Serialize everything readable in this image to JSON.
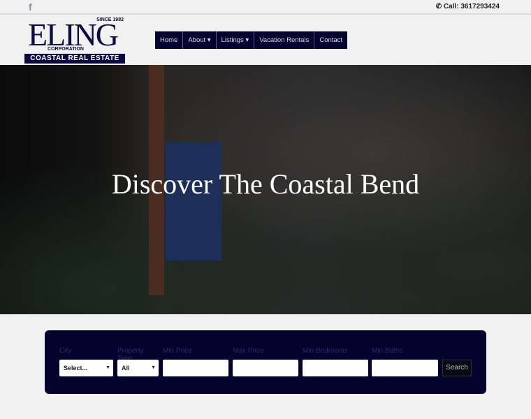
{
  "topbar": {
    "facebook_icon": "f",
    "call_label": "Call: 3617293424",
    "phone_icon": "phone-icon"
  },
  "logo": {
    "since": "SINCE 1982",
    "word": "ELING",
    "corp": "CORPORATION",
    "tagline": "COASTAL REAL ESTATE"
  },
  "nav": {
    "items": [
      {
        "label": "Home"
      },
      {
        "label": "About ▾"
      },
      {
        "label": "Listings ▾"
      },
      {
        "label": "Vacation Rentals"
      },
      {
        "label": "Contact"
      }
    ]
  },
  "hero": {
    "title": "Discover The Coastal Bend"
  },
  "search": {
    "city": {
      "label": "City",
      "value": "Select..."
    },
    "property_type": {
      "label": "Property Type",
      "value": "All"
    },
    "min_price": {
      "label": "Min Price",
      "value": ""
    },
    "max_price": {
      "label": "Max Price",
      "value": ""
    },
    "min_bedrooms": {
      "label": "Min Bedrooms",
      "value": ""
    },
    "min_baths": {
      "label": "Min Baths",
      "value": ""
    },
    "button": "Search"
  },
  "colors": {
    "navy": "#03032e",
    "background": "#f1f1f1"
  }
}
